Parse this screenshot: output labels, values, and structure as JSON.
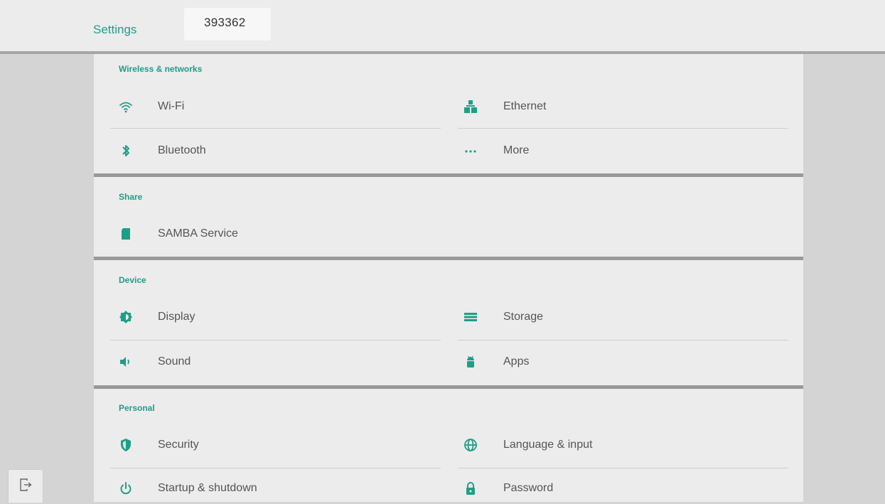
{
  "header": {
    "title": "Settings",
    "device_id": "393362"
  },
  "sections": {
    "wireless": {
      "title": "Wireless & networks",
      "wifi": "Wi-Fi",
      "ethernet": "Ethernet",
      "bluetooth": "Bluetooth",
      "more": "More"
    },
    "share": {
      "title": "Share",
      "samba": "SAMBA Service"
    },
    "device": {
      "title": "Device",
      "display": "Display",
      "storage": "Storage",
      "sound": "Sound",
      "apps": "Apps"
    },
    "personal": {
      "title": "Personal",
      "security": "Security",
      "language": "Language & input",
      "startup": "Startup & shutdown",
      "password": "Password"
    }
  },
  "icons": {
    "wifi": "wifi-icon",
    "ethernet": "ethernet-icon",
    "bluetooth": "bluetooth-icon",
    "more": "more-dots-icon",
    "samba": "sd-card-icon",
    "display": "brightness-icon",
    "storage": "storage-icon",
    "sound": "volume-icon",
    "apps": "android-icon",
    "security": "shield-icon",
    "language": "globe-icon",
    "startup": "power-icon",
    "password": "lock-icon",
    "exit": "exit-icon"
  },
  "colors": {
    "accent": "#1f9e87",
    "background": "#ececec",
    "text": "#555555"
  }
}
